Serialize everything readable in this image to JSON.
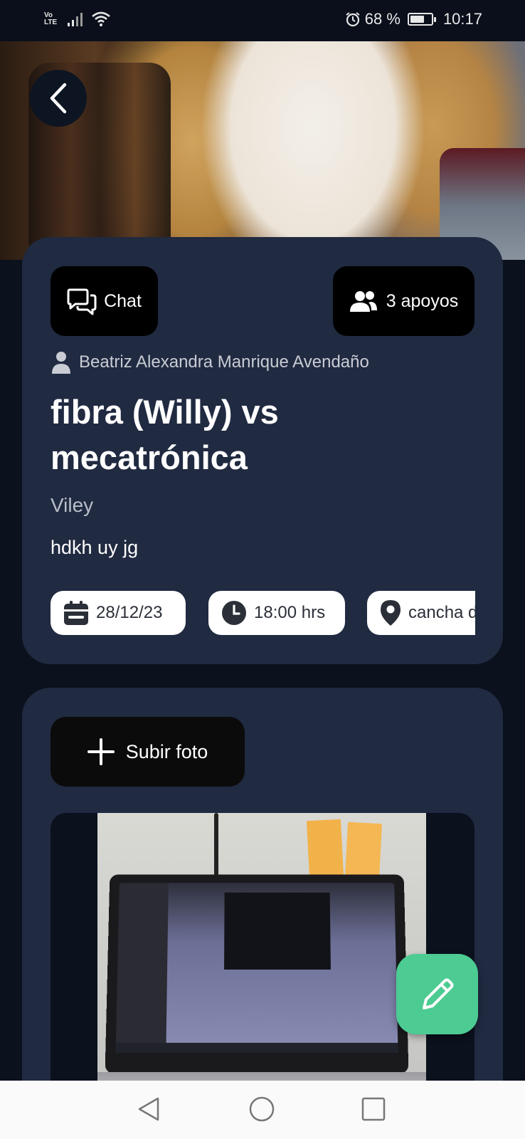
{
  "status_bar": {
    "network_label": "Vo\nLTE",
    "battery_percent": "68 %",
    "battery_level": 0.68,
    "time": "10:17",
    "icons": [
      "volte-icon",
      "signal-icon",
      "wifi-icon",
      "alarm-icon",
      "battery-icon"
    ]
  },
  "header": {
    "back_icon": "chevron-left-icon"
  },
  "event": {
    "chat_label": "Chat",
    "supporters_label": "3 apoyos",
    "organizer": "Beatriz Alexandra Manrique Avendaño",
    "title": "fibra (Willy) vs mecatrónica",
    "subtitle": "Viley",
    "description": "hdkh uy jg",
    "date": "28/12/23",
    "time": "18:00 hrs",
    "place": "cancha de"
  },
  "photos": {
    "upload_label": "Subir foto"
  },
  "colors": {
    "background": "#0b111d",
    "card": "#202a41",
    "button_dark": "#000000",
    "fab": "#4ccb93",
    "chip": "#ffffff"
  }
}
